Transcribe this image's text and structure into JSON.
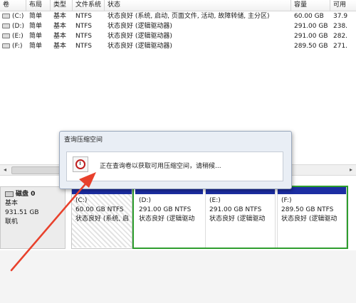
{
  "columns": [
    "卷",
    "布局",
    "类型",
    "文件系统",
    "状态",
    "容量",
    "可用"
  ],
  "volumes": [
    {
      "name": "(C:)",
      "layout": "简单",
      "type": "基本",
      "fs": "NTFS",
      "status": "状态良好 (系统, 启动, 页面文件, 活动, 故障转储, 主分区)",
      "capacity": "60.00 GB",
      "free": "37.9"
    },
    {
      "name": "(D:)",
      "layout": "简单",
      "type": "基本",
      "fs": "NTFS",
      "status": "状态良好 (逻辑驱动器)",
      "capacity": "291.00 GB",
      "free": "238."
    },
    {
      "name": "(E:)",
      "layout": "简单",
      "type": "基本",
      "fs": "NTFS",
      "status": "状态良好 (逻辑驱动器)",
      "capacity": "291.00 GB",
      "free": "282."
    },
    {
      "name": "(F:)",
      "layout": "简单",
      "type": "基本",
      "fs": "NTFS",
      "status": "状态良好 (逻辑驱动器)",
      "capacity": "289.50 GB",
      "free": "271."
    }
  ],
  "scroll": {
    "left_arrow": "◂",
    "right_arrow": "▸"
  },
  "disk": {
    "name": "磁盘 0",
    "type": "基本",
    "size": "931.51 GB",
    "state": "联机"
  },
  "partitions": [
    {
      "label": "(C:)",
      "size": "60.00 GB NTFS",
      "status": "状态良好 (系统, 启"
    },
    {
      "label": "(D:)",
      "size": "291.00 GB NTFS",
      "status": "状态良好 (逻辑驱动"
    },
    {
      "label": "(E:)",
      "size": "291.00 GB NTFS",
      "status": "状态良好 (逻辑驱动"
    },
    {
      "label": "(F:)",
      "size": "289.50 GB NTFS",
      "status": "状态良好 (逻辑驱动"
    }
  ],
  "dialog": {
    "title": "查询压缩空间",
    "message": "正在查询卷以获取可用压缩空间，请稍候..."
  },
  "colors": {
    "partition_bar": "#1c2ea3",
    "extended_frame": "#2e9e2e",
    "arrow": "#e8412c",
    "clock": "#c01d1d"
  },
  "icons": {
    "drive": "drive-icon",
    "disk": "disk-icon",
    "dialog": "clock-icon"
  }
}
